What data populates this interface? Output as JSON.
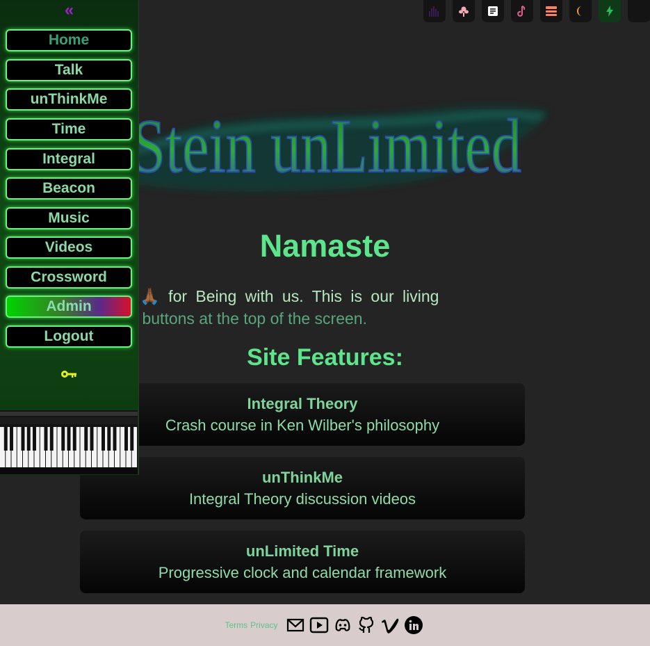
{
  "toolbar": {
    "buttons": [
      {
        "name": "spectrum-icon",
        "color": "#3a1c52"
      },
      {
        "name": "lotus-icon",
        "color": "#f5a8b8"
      },
      {
        "name": "notes-icon",
        "color": "#ffffff"
      },
      {
        "name": "music-note-icon",
        "color": "#e06090"
      },
      {
        "name": "layout-icon",
        "color": "#ff8060"
      },
      {
        "name": "moon-icon",
        "color": "#f0a040"
      },
      {
        "name": "bolt-icon",
        "color": "#22c05a"
      },
      {
        "name": "blank-icon",
        "color": "#141414"
      }
    ]
  },
  "logo": {
    "text": "Stein unLimited"
  },
  "main": {
    "greeting": "Namaste",
    "intro_lead": "nk you 🙏🏾 for Being with us. This is our living",
    "intro_hint": ". Try the buttons at the top of the screen.",
    "features_heading": "Site Features:",
    "features": [
      {
        "title": "Integral Theory",
        "desc": "Crash course in Ken Wilber's philosophy"
      },
      {
        "title": "unThinkMe",
        "desc": "Integral Theory discussion videos"
      },
      {
        "title": "unLimited Time",
        "desc": "Progressive clock and calendar framework"
      }
    ]
  },
  "sidebar": {
    "collapse_label": "«",
    "nav": [
      {
        "label": "Home"
      },
      {
        "label": "Talk"
      },
      {
        "label": "unThinkMe"
      },
      {
        "label": "Time"
      },
      {
        "label": "Integral"
      },
      {
        "label": "Beacon"
      },
      {
        "label": "Music"
      },
      {
        "label": "Videos"
      },
      {
        "label": "Crossword"
      },
      {
        "label": "Admin"
      },
      {
        "label": "Logout"
      }
    ],
    "active": "Home",
    "key_icon": "key-icon",
    "piano": "piano-keyboard"
  },
  "footer": {
    "terms": "Terms",
    "privacy": "Privacy",
    "social": [
      "email-icon",
      "youtube-icon",
      "discord-icon",
      "github-icon",
      "vimeo-icon",
      "linkedin-icon"
    ]
  },
  "colors": {
    "accent": "#5de58c",
    "text": "#9ed9b0",
    "background": "#242424",
    "footer": "#d8cccc",
    "nav_border": "#6ef07e"
  }
}
